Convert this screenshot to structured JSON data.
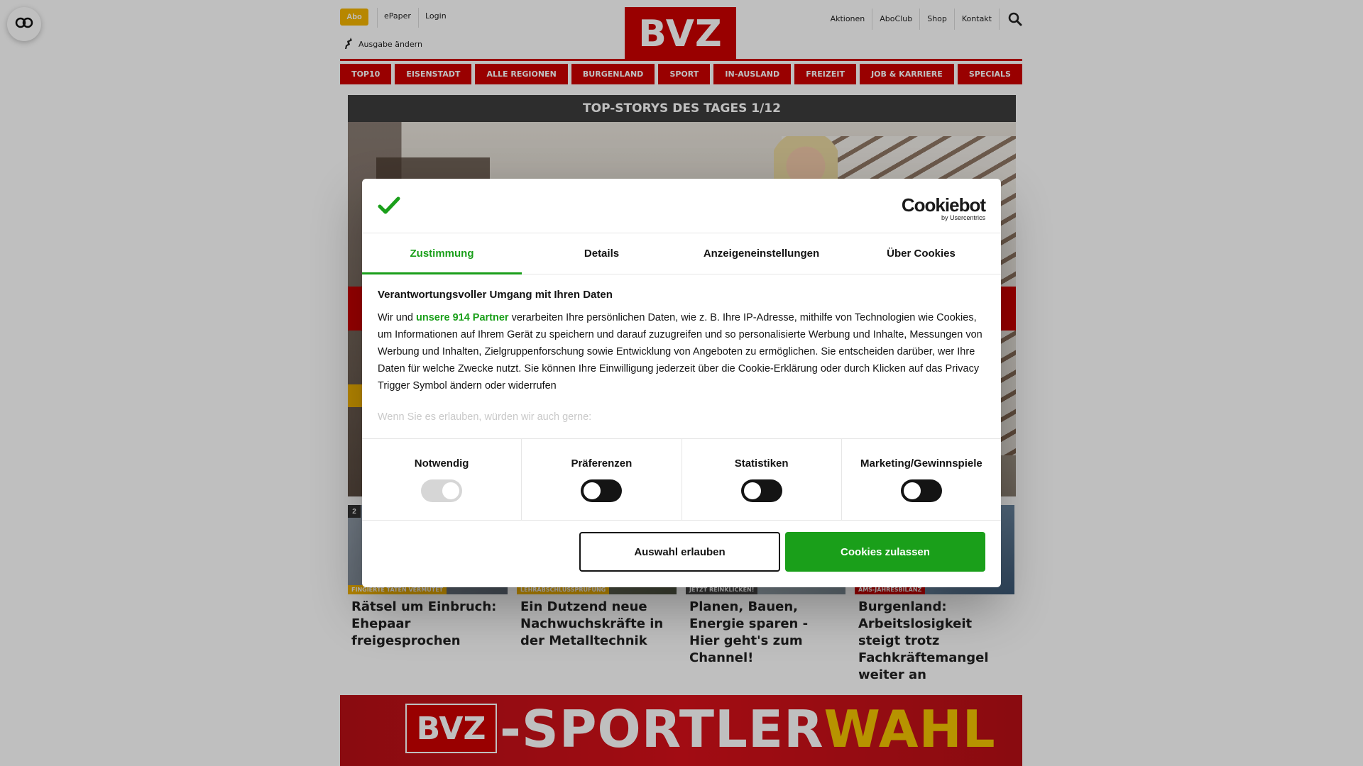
{
  "header": {
    "abo_label": "Abo",
    "epaper_label": "ePaper",
    "login_label": "Login",
    "ausgabe_label": "Ausgabe ändern",
    "logo_text": "BVZ",
    "util_links": [
      "Aktionen",
      "AboClub",
      "Shop",
      "Kontakt"
    ]
  },
  "nav": {
    "items": [
      "TOP10",
      "EISENSTADT",
      "ALLE REGIONEN",
      "BURGENLAND",
      "SPORT",
      "IN-AUSLAND",
      "FREIZEIT",
      "JOB & KARRIERE",
      "SPECIALS"
    ]
  },
  "stories": {
    "bar_title": "TOP-STORYS DES TAGES 1/12",
    "cards": [
      {
        "rank": "2",
        "kicker": "FINGIERTE TATEN VERMUTET",
        "headline": "Rätsel um Einbruch: Ehepaar freigesprochen"
      },
      {
        "rank": "",
        "kicker": "LEHRABSCHLUSSPRÜFUNG",
        "headline": "Ein Dutzend neue Nachwuchskräfte in der Metalltechnik"
      },
      {
        "rank": "",
        "kicker": "JETZT REINKLICKEN!",
        "headline": "Planen, Bauen, Energie sparen - Hier geht's zum Channel!"
      },
      {
        "rank": "",
        "kicker": "AMS-JAHRESBILANZ",
        "headline": "Burgenland: Arbeitslosigkeit steigt trotz Fachkräftemangel weiter an"
      }
    ]
  },
  "banner": {
    "logo_text": "BVZ",
    "title_main": "-SPORTLER",
    "title_accent": "WAHL"
  },
  "cookie_dialog": {
    "brand_name": "Cookiebot",
    "brand_by": "by Usercentrics",
    "tabs": [
      "Zustimmung",
      "Details",
      "Anzeigeneinstellungen",
      "Über Cookies"
    ],
    "active_tab": "Zustimmung",
    "heading": "Verantwortungsvoller Umgang mit Ihren Daten",
    "para_before_link": "Wir und ",
    "partner_link": "unsere 914 Partner",
    "para_after_link": " verarbeiten Ihre persönlichen Daten, wie z. B. Ihre IP-Adresse, mithilfe von Technologien wie Cookies, um Informationen auf Ihrem Gerät zu speichern und darauf zuzugreifen und so personalisierte Werbung und Inhalte, Messungen von Werbung und Inhalten, Zielgruppenforschung sowie Entwicklung von Angeboten zu ermöglichen. Sie entscheiden darüber, wer Ihre Daten für welche Zwecke nutzt. Sie können Ihre Einwilligung jederzeit über die Cookie-Erklärung oder durch Klicken auf das Privacy Trigger Symbol ändern oder widerrufen",
    "faded_text": "Wenn Sie es erlauben, würden wir auch gerne:",
    "consents": [
      {
        "label": "Notwendig",
        "state": "on-disabled"
      },
      {
        "label": "Präferenzen",
        "state": "off"
      },
      {
        "label": "Statistiken",
        "state": "off"
      },
      {
        "label": "Marketing/Gewinnspiele",
        "state": "off"
      }
    ],
    "btn_allow_selection": "Auswahl erlauben",
    "btn_allow_all": "Cookies zulassen"
  },
  "colors": {
    "brand_red": "#cc0000",
    "accent_yellow": "#f4b400",
    "consent_green": "#1a9f1a"
  }
}
